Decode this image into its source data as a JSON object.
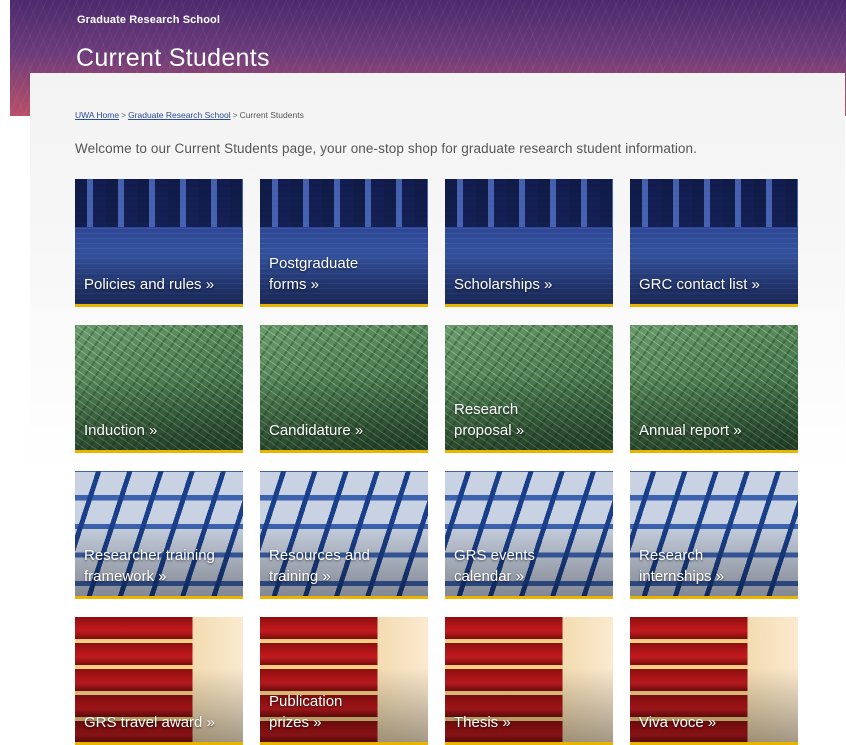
{
  "header": {
    "site_name": "Graduate Research School",
    "page_title": "Current Students"
  },
  "breadcrumb": {
    "items": [
      {
        "label": "UWA Home",
        "link": true
      },
      {
        "label": "Graduate Research School",
        "link": true
      },
      {
        "label": "Current Students",
        "link": false
      }
    ],
    "separator": ">"
  },
  "intro": "Welcome to our Current Students page, your one-stop shop for graduate research student information.",
  "tiles": [
    {
      "line1": "Policies and rules »",
      "line2": "",
      "theme": "blue"
    },
    {
      "line1": "Postgraduate",
      "line2": "forms »",
      "theme": "blue"
    },
    {
      "line1": "Scholarships »",
      "line2": "",
      "theme": "blue"
    },
    {
      "line1": "GRC contact list »",
      "line2": "",
      "theme": "blue"
    },
    {
      "line1": "Induction »",
      "line2": "",
      "theme": "green"
    },
    {
      "line1": "Candidature »",
      "line2": "",
      "theme": "green"
    },
    {
      "line1": "Research",
      "line2": "proposal »",
      "theme": "green"
    },
    {
      "line1": "Annual report »",
      "line2": "",
      "theme": "green"
    },
    {
      "line1": "Researcher training",
      "line2": "framework »",
      "theme": "keys"
    },
    {
      "line1": "Resources and",
      "line2": "training »",
      "theme": "keys"
    },
    {
      "line1": "GRS events",
      "line2": "calendar »",
      "theme": "keys"
    },
    {
      "line1": "Research",
      "line2": "internships »",
      "theme": "keys"
    },
    {
      "line1": "GRS travel award »",
      "line2": "",
      "theme": "books"
    },
    {
      "line1": "Publication",
      "line2": "prizes »",
      "theme": "books"
    },
    {
      "line1": "Thesis »",
      "line2": "",
      "theme": "books"
    },
    {
      "line1": "Viva voce »",
      "line2": "",
      "theme": "books"
    }
  ]
}
